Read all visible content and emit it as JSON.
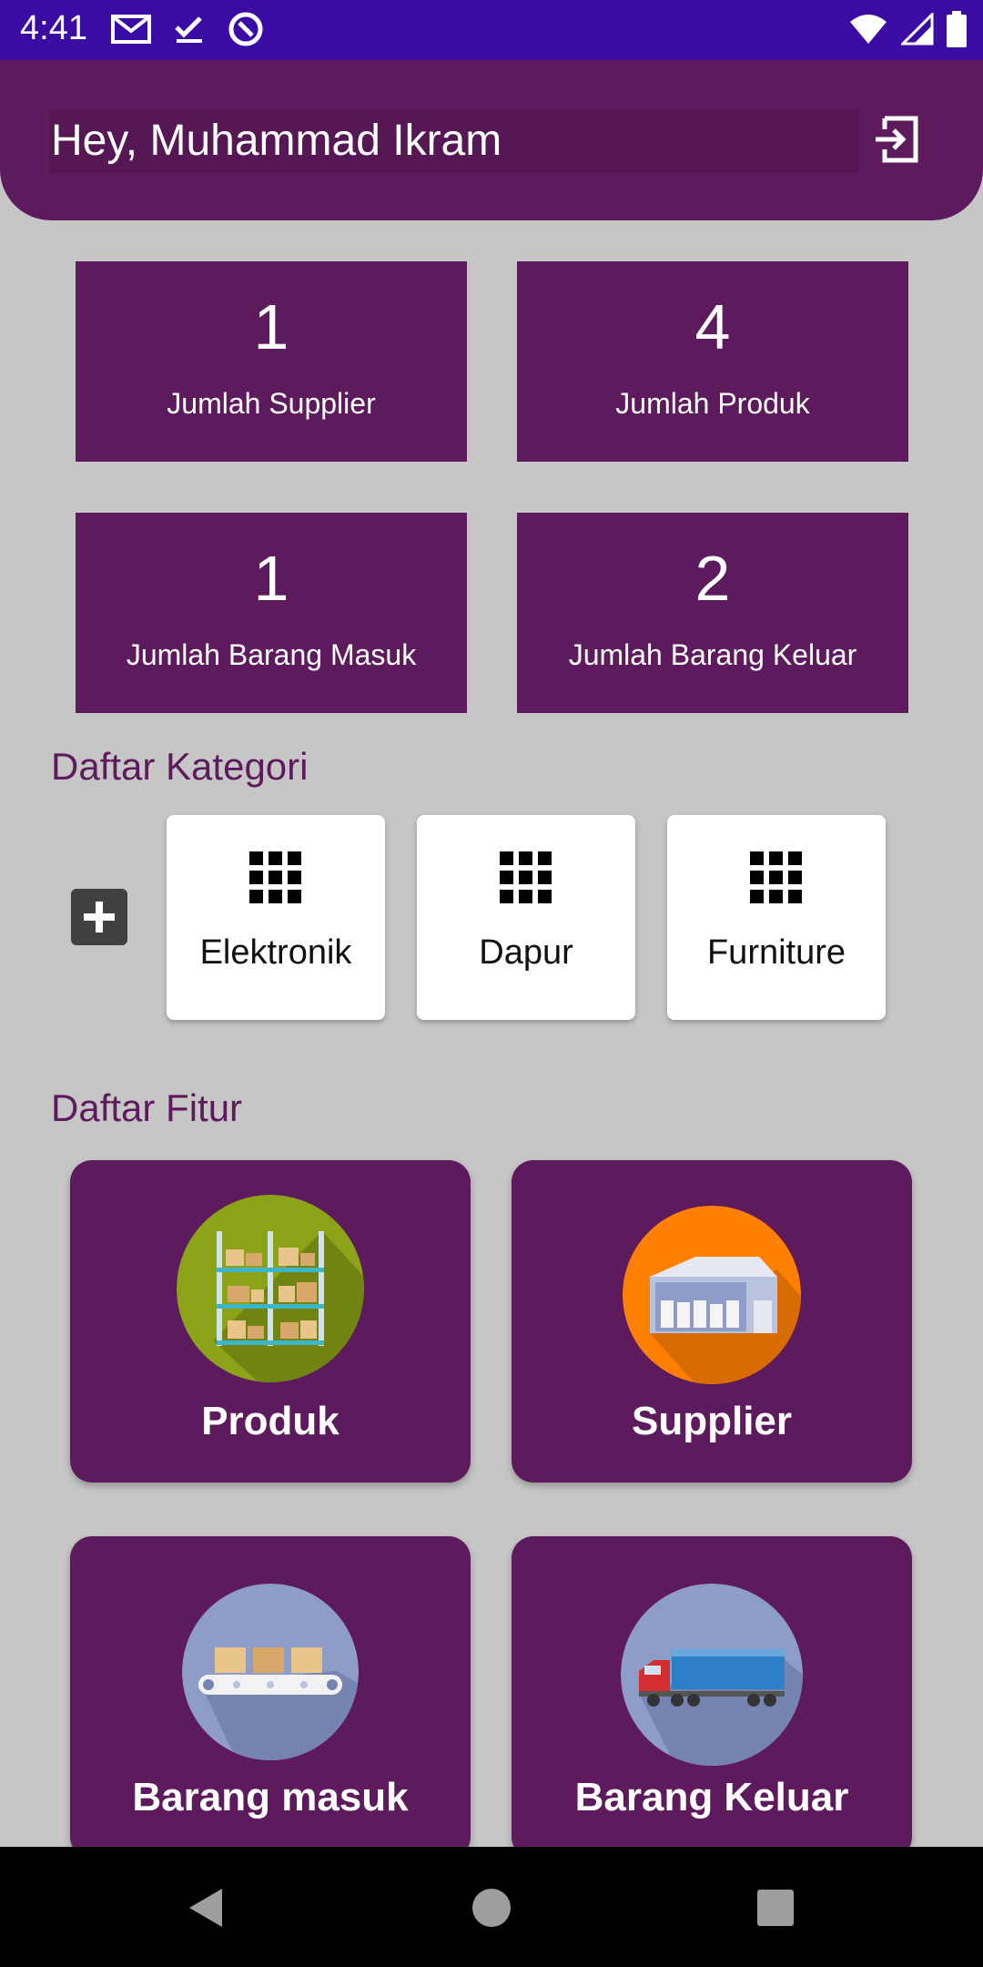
{
  "status_bar": {
    "time": "4:41",
    "icons": [
      "gmail-icon",
      "check-icon",
      "at-sign-icon",
      "wifi-icon",
      "signal-icon",
      "battery-icon"
    ]
  },
  "header": {
    "greeting": "Hey, Muhammad Ikram",
    "logout_icon": "logout-icon"
  },
  "stats": [
    {
      "value": "1",
      "label": "Jumlah Supplier"
    },
    {
      "value": "4",
      "label": "Jumlah Produk"
    },
    {
      "value": "1",
      "label": "Jumlah Barang Masuk"
    },
    {
      "value": "2",
      "label": "Jumlah Barang Keluar"
    }
  ],
  "categories": {
    "title": "Daftar Kategori",
    "add_icon": "plus-icon",
    "items": [
      {
        "label": "Elektronik",
        "icon": "grid-icon"
      },
      {
        "label": "Dapur",
        "icon": "grid-icon"
      },
      {
        "label": "Furniture",
        "icon": "grid-icon"
      }
    ]
  },
  "features": {
    "title": "Daftar Fitur",
    "items": [
      {
        "label": "Produk",
        "icon": "warehouse-shelf-icon",
        "color": "#8ca318"
      },
      {
        "label": "Supplier",
        "icon": "warehouse-building-icon",
        "color": "#ff8000"
      },
      {
        "label": "Barang masuk",
        "icon": "conveyor-belt-icon",
        "color": "#8e9cc8"
      },
      {
        "label": "Barang Keluar",
        "icon": "truck-icon",
        "color": "#8e9cc8"
      }
    ]
  },
  "colors": {
    "primary": "#5d1a5c",
    "status_bar": "#3a0ca3",
    "background": "#c6c6c6"
  },
  "nav_bar": [
    "back-icon",
    "home-icon",
    "recents-icon"
  ]
}
